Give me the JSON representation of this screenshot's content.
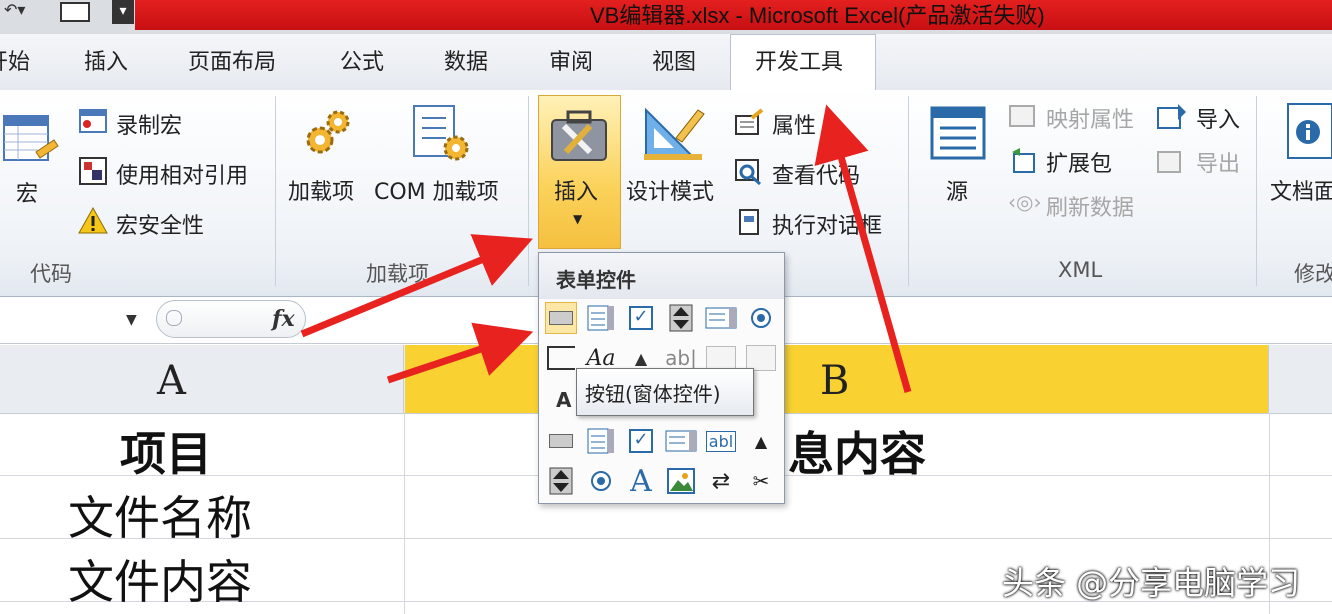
{
  "title": "VB编辑器.xlsx - Microsoft Excel(产品激活失败)",
  "tabs": [
    {
      "label": "开始"
    },
    {
      "label": "插入"
    },
    {
      "label": "页面布局"
    },
    {
      "label": "公式"
    },
    {
      "label": "数据"
    },
    {
      "label": "审阅"
    },
    {
      "label": "视图"
    },
    {
      "label": "开发工具",
      "active": true
    }
  ],
  "ribbon": {
    "code": {
      "group_label": "代码",
      "macro": "宏",
      "record_macro": "录制宏",
      "relative_ref": "使用相对引用",
      "macro_security": "宏安全性"
    },
    "addins": {
      "group_label": "加载项",
      "addins": "加载项",
      "com_addins": "COM 加载项"
    },
    "controls": {
      "insert": "插入",
      "design_mode": "设计模式",
      "properties": "属性",
      "view_code": "查看代码",
      "run_dialog": "执行对话框"
    },
    "xml": {
      "group_label": "XML",
      "source": "源",
      "map_properties": "映射属性",
      "expansion_packs": "扩展包",
      "refresh_data": "刷新数据",
      "import": "导入",
      "export": "导出"
    },
    "modify": {
      "group_label": "修改",
      "doc_panel": "文档面"
    }
  },
  "formula_bar": {
    "fx": "fx"
  },
  "dropdown": {
    "form_controls_header": "表单控件",
    "activex_header": "A",
    "tooltip": "按钮(窗体控件)"
  },
  "sheet": {
    "columns": [
      "A",
      "B"
    ],
    "rows": [
      {
        "a": "项目",
        "b": "息内容"
      },
      {
        "a": "文件名称",
        "b": ""
      },
      {
        "a": "文件内容",
        "b": ""
      }
    ]
  },
  "watermark": "头条 @分享电脑学习",
  "colors": {
    "accent_red": "#e3201f",
    "highlight_yellow": "#f9d232",
    "arrow_red": "#e8231f"
  }
}
